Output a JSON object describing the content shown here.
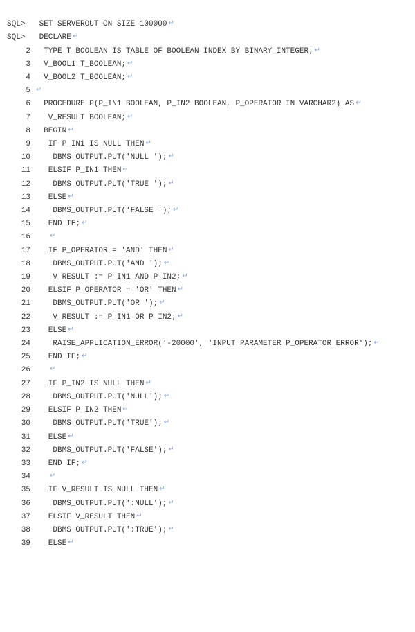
{
  "pilcrow": "↵",
  "prompt": "SQL>",
  "header_lines": [
    {
      "text": "SET SERVEROUT ON SIZE 100000",
      "pil": true
    },
    {
      "text": "DECLARE",
      "pil": true
    }
  ],
  "code_lines": [
    {
      "n": 2,
      "indent": 2,
      "text": "TYPE T_BOOLEAN IS TABLE OF BOOLEAN INDEX BY BINARY_INTEGER;",
      "pil": true
    },
    {
      "n": 3,
      "indent": 2,
      "text": "V_BOOL1 T_BOOLEAN;",
      "pil": true
    },
    {
      "n": 4,
      "indent": 2,
      "text": "V_BOOL2 T_BOOLEAN;",
      "pil": true
    },
    {
      "n": 5,
      "indent": 0,
      "text": "",
      "pil": true
    },
    {
      "n": 6,
      "indent": 2,
      "text": "PROCEDURE P(P_IN1 BOOLEAN, P_IN2 BOOLEAN, P_OPERATOR IN VARCHAR2) AS",
      "pil": true
    },
    {
      "n": 7,
      "indent": 3,
      "text": "V_RESULT BOOLEAN;",
      "pil": true
    },
    {
      "n": 8,
      "indent": 2,
      "text": "BEGIN",
      "pil": true
    },
    {
      "n": 9,
      "indent": 3,
      "text": "IF P_IN1 IS NULL THEN",
      "pil": true
    },
    {
      "n": 10,
      "indent": 4,
      "text": "DBMS_OUTPUT.PUT('NULL ');",
      "pil": true
    },
    {
      "n": 11,
      "indent": 3,
      "text": "ELSIF P_IN1 THEN",
      "pil": true
    },
    {
      "n": 12,
      "indent": 4,
      "text": "DBMS_OUTPUT.PUT('TRUE ');",
      "pil": true
    },
    {
      "n": 13,
      "indent": 3,
      "text": "ELSE",
      "pil": true
    },
    {
      "n": 14,
      "indent": 4,
      "text": "DBMS_OUTPUT.PUT('FALSE ');",
      "pil": true
    },
    {
      "n": 15,
      "indent": 3,
      "text": "END IF;",
      "pil": true
    },
    {
      "n": 16,
      "indent": 3,
      "text": "",
      "pil": true
    },
    {
      "n": 17,
      "indent": 3,
      "text": "IF P_OPERATOR = 'AND' THEN",
      "pil": true
    },
    {
      "n": 18,
      "indent": 4,
      "text": "DBMS_OUTPUT.PUT('AND ');",
      "pil": true
    },
    {
      "n": 19,
      "indent": 4,
      "text": "V_RESULT := P_IN1 AND P_IN2;",
      "pil": true
    },
    {
      "n": 20,
      "indent": 3,
      "text": "ELSIF P_OPERATOR = 'OR' THEN",
      "pil": true
    },
    {
      "n": 21,
      "indent": 4,
      "text": "DBMS_OUTPUT.PUT('OR ');",
      "pil": true
    },
    {
      "n": 22,
      "indent": 4,
      "text": "V_RESULT := P_IN1 OR P_IN2;",
      "pil": true
    },
    {
      "n": 23,
      "indent": 3,
      "text": "ELSE",
      "pil": true
    },
    {
      "n": 24,
      "indent": 4,
      "text": "RAISE_APPLICATION_ERROR('-20000', 'INPUT PARAMETER P_OPERATOR ERROR');",
      "pil": true
    },
    {
      "n": 25,
      "indent": 3,
      "text": "END IF;",
      "pil": true
    },
    {
      "n": 26,
      "indent": 3,
      "text": "",
      "pil": true
    },
    {
      "n": 27,
      "indent": 3,
      "text": "IF P_IN2 IS NULL THEN",
      "pil": true
    },
    {
      "n": 28,
      "indent": 4,
      "text": "DBMS_OUTPUT.PUT('NULL');",
      "pil": true
    },
    {
      "n": 29,
      "indent": 3,
      "text": "ELSIF P_IN2 THEN",
      "pil": true
    },
    {
      "n": 30,
      "indent": 4,
      "text": "DBMS_OUTPUT.PUT('TRUE');",
      "pil": true
    },
    {
      "n": 31,
      "indent": 3,
      "text": "ELSE",
      "pil": true
    },
    {
      "n": 32,
      "indent": 4,
      "text": "DBMS_OUTPUT.PUT('FALSE');",
      "pil": true
    },
    {
      "n": 33,
      "indent": 3,
      "text": "END IF;",
      "pil": true
    },
    {
      "n": 34,
      "indent": 3,
      "text": "",
      "pil": true
    },
    {
      "n": 35,
      "indent": 3,
      "text": "IF V_RESULT IS NULL THEN",
      "pil": true
    },
    {
      "n": 36,
      "indent": 4,
      "text": "DBMS_OUTPUT.PUT(':NULL');",
      "pil": true
    },
    {
      "n": 37,
      "indent": 3,
      "text": "ELSIF V_RESULT THEN",
      "pil": true
    },
    {
      "n": 38,
      "indent": 4,
      "text": "DBMS_OUTPUT.PUT(':TRUE');",
      "pil": true
    },
    {
      "n": 39,
      "indent": 3,
      "text": "ELSE",
      "pil": true
    }
  ]
}
